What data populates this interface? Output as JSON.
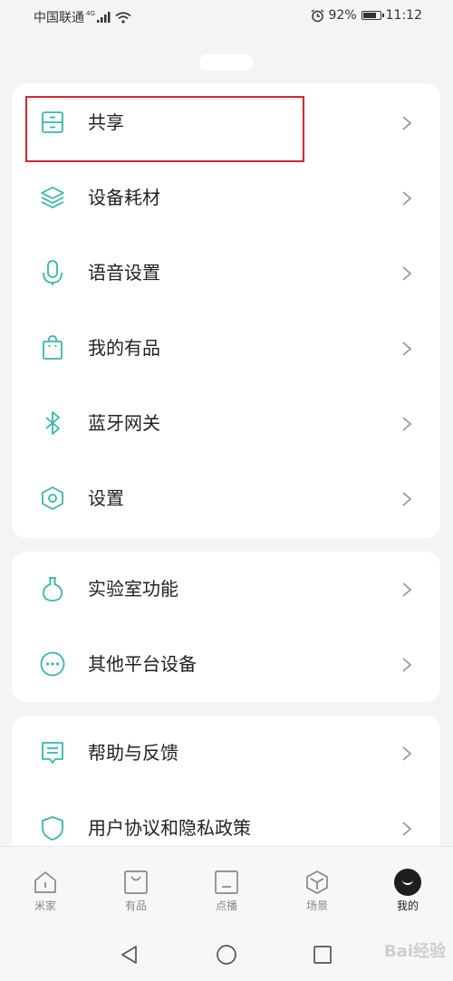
{
  "status_bar": {
    "carrier": "中国联通",
    "network": "4G",
    "battery": "92%",
    "battery_level": 0.92,
    "time": "11:12"
  },
  "menu_group_1": [
    {
      "label": "共享",
      "icon": "share-drawer-icon",
      "highlighted": true
    },
    {
      "label": "设备耗材",
      "icon": "layers-icon"
    },
    {
      "label": "语音设置",
      "icon": "microphone-icon"
    },
    {
      "label": "我的有品",
      "icon": "shopping-bag-icon"
    },
    {
      "label": "蓝牙网关",
      "icon": "bluetooth-icon"
    },
    {
      "label": "设置",
      "icon": "hexagon-settings-icon"
    }
  ],
  "menu_group_2": [
    {
      "label": "实验室功能",
      "icon": "flask-icon"
    },
    {
      "label": "其他平台设备",
      "icon": "more-dots-icon"
    }
  ],
  "menu_group_3": [
    {
      "label": "帮助与反馈",
      "icon": "feedback-icon"
    },
    {
      "label": "用户协议和隐私政策",
      "icon": "shield-icon"
    }
  ],
  "tabs": [
    {
      "label": "米家",
      "icon": "home-icon",
      "active": false
    },
    {
      "label": "有品",
      "icon": "store-bag-icon",
      "active": false
    },
    {
      "label": "点播",
      "icon": "tv-icon",
      "active": false
    },
    {
      "label": "场景",
      "icon": "cube-icon",
      "active": false
    },
    {
      "label": "我的",
      "icon": "me-icon",
      "active": true
    }
  ],
  "colors": {
    "accent": "#3ab5a9",
    "highlight_border": "#d7242b",
    "chevron": "#9a9a9a"
  },
  "watermark": "Bai经验"
}
